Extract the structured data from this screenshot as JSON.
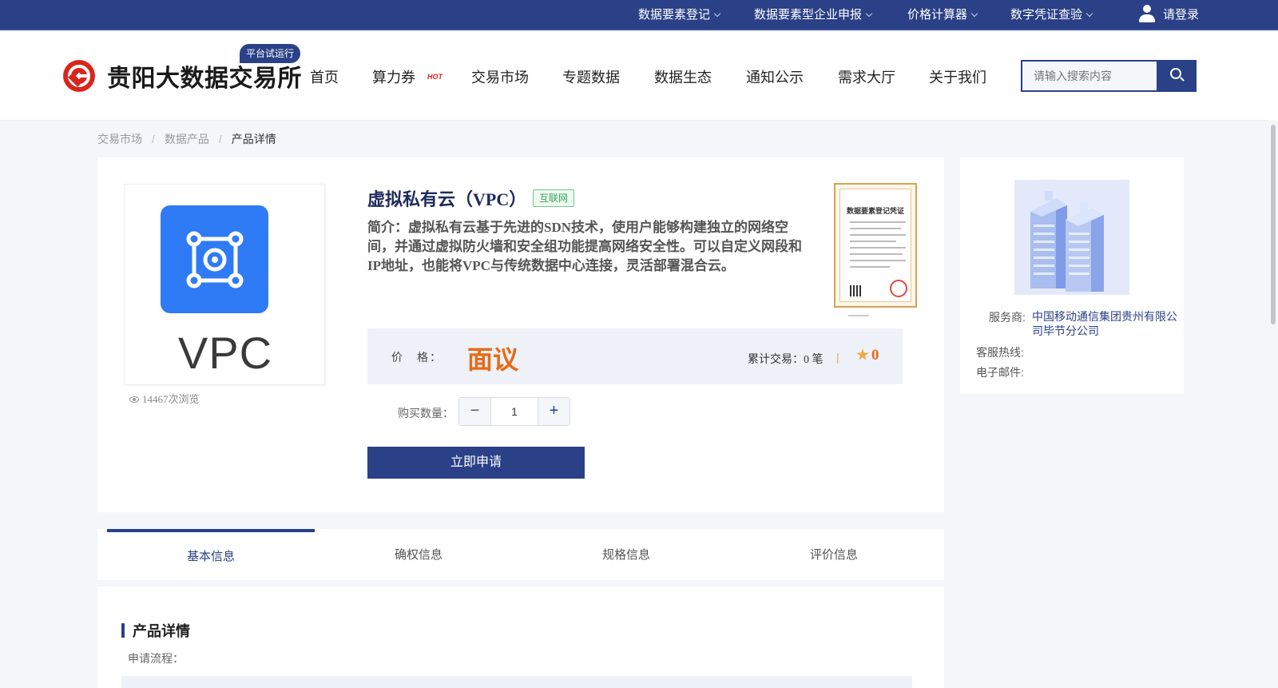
{
  "topbar": {
    "items": [
      {
        "label": "数据要素登记"
      },
      {
        "label": "数据要素型企业申报"
      },
      {
        "label": "价格计算器"
      },
      {
        "label": "数字凭证查验"
      }
    ],
    "login": "请登录"
  },
  "header": {
    "brand": "贵阳大数据交易所",
    "trial_badge": "平台试运行",
    "nav": [
      {
        "label": "首页"
      },
      {
        "label": "算力券"
      },
      {
        "label": "交易市场"
      },
      {
        "label": "专题数据"
      },
      {
        "label": "数据生态"
      },
      {
        "label": "通知公示"
      },
      {
        "label": "需求大厅"
      },
      {
        "label": "关于我们"
      }
    ],
    "hot_badge": "HOT",
    "search_placeholder": "请输入搜索内容"
  },
  "breadcrumb": {
    "items": [
      "交易市场",
      "数据产品"
    ],
    "current": "产品详情"
  },
  "product": {
    "image_text": "VPC",
    "views": "14467次浏览",
    "title": "虚拟私有云（VPC）",
    "tag": "互联网",
    "intro": "简介：虚拟私有云基于先进的SDN技术，使用户能够构建独立的网络空间，并通过虚拟防火墙和安全组功能提高网络安全性。可以自定义网段和IP地址，也能将VPC与传统数据中心连接，灵活部署混合云。",
    "certificate_title": "数据要素登记凭证",
    "price_label": "价　格：",
    "price_value": "面议",
    "trade_count": "累计交易：0 笔",
    "trade_sep": "|",
    "rating": "0",
    "quantity_label": "购买数量：",
    "quantity": "1",
    "minus": "−",
    "plus": "+",
    "apply_button": "立即申请"
  },
  "provider": {
    "service_label": "服务商:",
    "service_value": "中国移动通信集团贵州有限公司毕节分公司",
    "hotline_label": "客服热线:",
    "email_label": "电子邮件:"
  },
  "tabs": [
    {
      "label": "基本信息",
      "active": true
    },
    {
      "label": "确权信息"
    },
    {
      "label": "规格信息"
    },
    {
      "label": "评价信息"
    }
  ],
  "detail": {
    "title": "产品详情",
    "flow_label": "申请流程："
  },
  "colors": {
    "brand_blue": "#2a4087",
    "price_orange": "#e86a16",
    "logo_red": "#d9261c",
    "tag_green": "#3aa35a"
  }
}
